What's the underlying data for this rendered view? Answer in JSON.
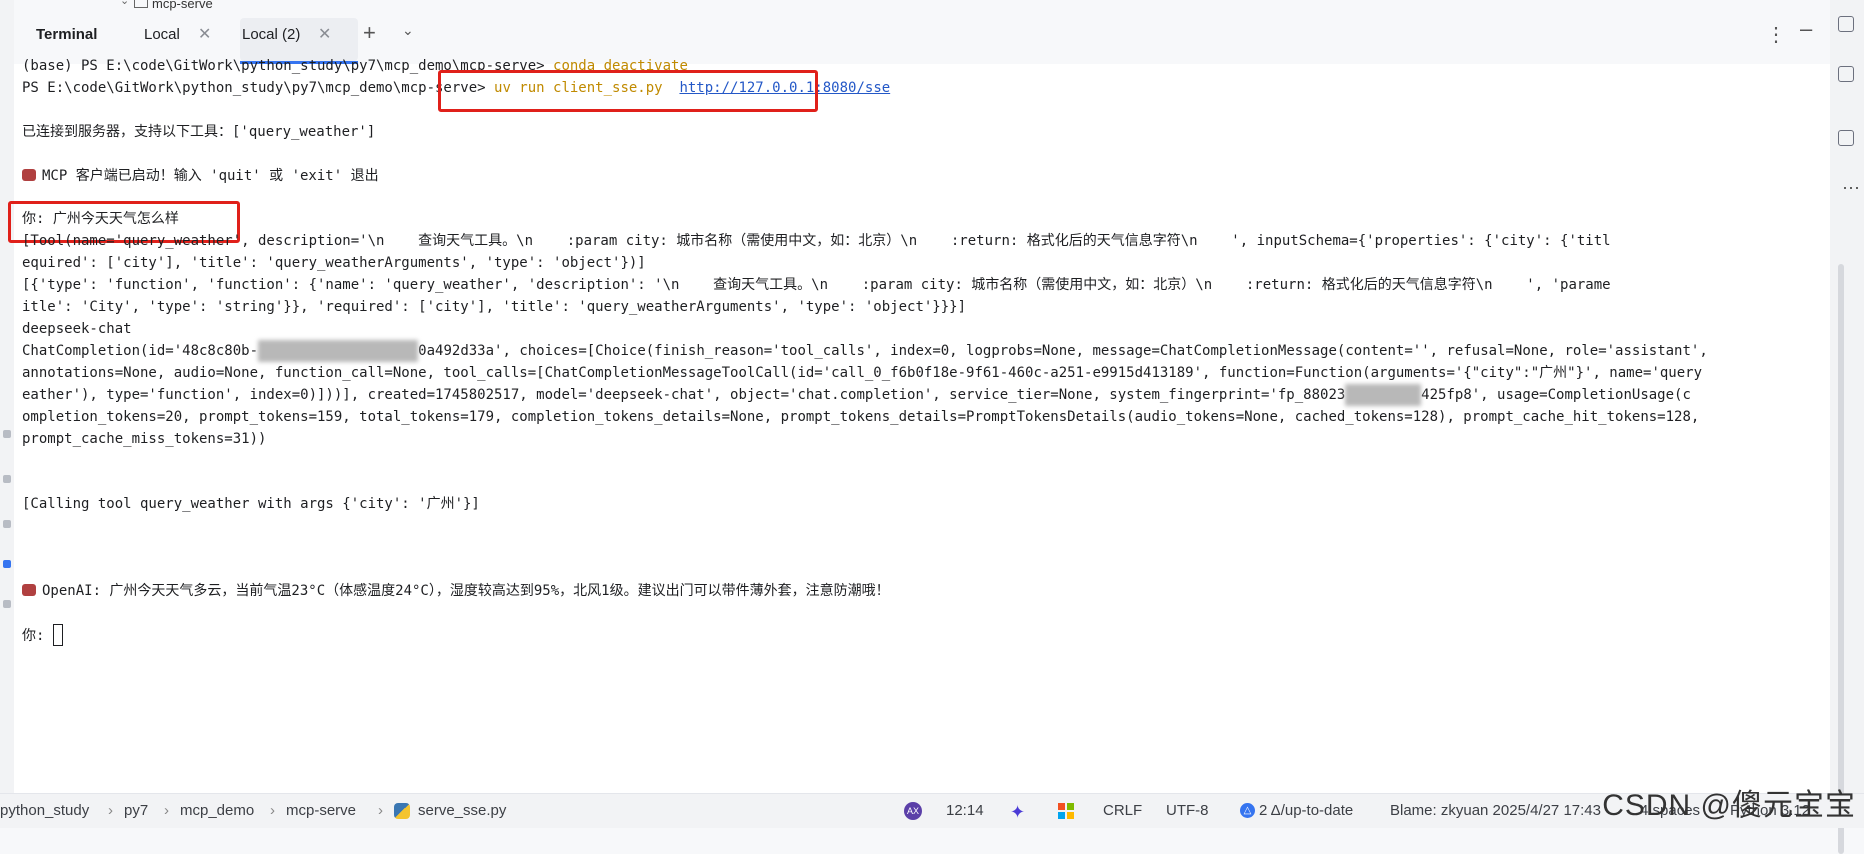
{
  "project_tree": {
    "folder": "mcp-serve"
  },
  "tabs": {
    "title": "Terminal",
    "items": [
      {
        "label": "Local"
      },
      {
        "label": "Local (2)"
      }
    ]
  },
  "terminal": {
    "lines": [
      "(base) PS E:\\code\\GitWork\\python_study\\py7\\mcp_demo\\mcp-serve> ",
      "PS E:\\code\\GitWork\\python_study\\py7\\mcp_demo\\mcp-serve> ",
      "已连接到服务器，支持以下工具：['query_weather']",
      "MCP 客户端已启动！输入 'quit' 或 'exit' 退出",
      "你: 广州今天天气怎么样",
      "[Tool(name='query_weather', description='\\n    查询天气工具。\\n    :param city: 城市名称（需使用中文，如：北京）\\n    :return: 格式化后的天气信息字符\\n    ', inputSchema={'properties': {'city': {'titl",
      "equired': ['city'], 'title': 'query_weatherArguments', 'type': 'object'})]",
      "[{'type': 'function', 'function': {'name': 'query_weather', 'description': '\\n    查询天气工具。\\n    :param city: 城市名称（需使用中文，如：北京）\\n    :return: 格式化后的天气信息字符\\n    ', 'parame",
      "itle': 'City', 'type': 'string'}}, 'required': ['city'], 'title': 'query_weatherArguments', 'type': 'object'}}}]",
      "deepseek-chat",
      "ChatCompletion(id='48c8c80b-",
      "0a492d33a', choices=[Choice(finish_reason='tool_calls', index=0, logprobs=None, message=ChatCompletionMessage(content='', refusal=None, role='assistant',",
      "annotations=None, audio=None, function_call=None, tool_calls=[ChatCompletionMessageToolCall(id='call_0_f6b0f18e-9f61-460c-a251-e9915d413189', function=Function(arguments='{\"city\":\"广州\"}', name='query",
      "eather'), type='function', index=0)]))], created=1745802517, model='deepseek-chat', object='chat.completion', service_tier=None, system_fingerprint='fp_88023",
      "425fp8', usage=CompletionUsage(c",
      "ompletion_tokens=20, prompt_tokens=159, total_tokens=179, completion_tokens_details=None, prompt_tokens_details=PromptTokensDetails(audio_tokens=None, cached_tokens=128), prompt_cache_hit_tokens=128,",
      "prompt_cache_miss_tokens=31))",
      "[Calling tool query_weather with args {'city': '广州'}]",
      "OpenAI: 广州今天天气多云，当前气温23°C（体感温度24°C），湿度较高达到95%，北风1级。建议出门可以带件薄外套，注意防潮哦！",
      "你: "
    ],
    "cmd1": "conda deactivate",
    "cmd2": "uv run client_sse.py",
    "url": "http://127.0.0.1:8080/sse"
  },
  "status": {
    "crumbs": [
      "python_study",
      "py7",
      "mcp_demo",
      "mcp-serve",
      "serve_sse.py"
    ],
    "ai_label": "AX",
    "time": "12:14",
    "line_sep": "CRLF",
    "encoding": "UTF-8",
    "vcs": "2 Δ/up-to-date",
    "blame": "Blame: zkyuan 2025/4/27 17:43",
    "indent": "4 spaces",
    "interpreter": "Python 3.12"
  },
  "watermark": "CSDN @傻元宝宝"
}
